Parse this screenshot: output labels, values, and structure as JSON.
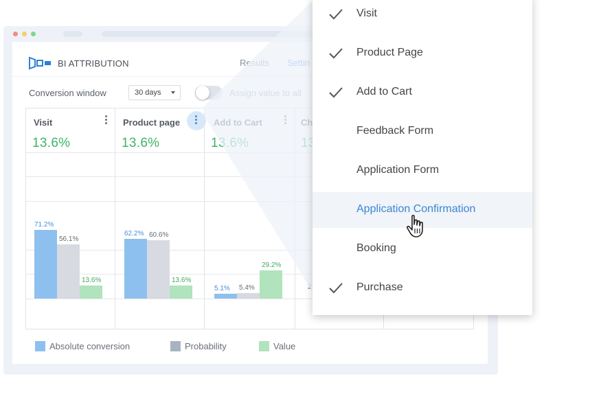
{
  "app": {
    "name": "BI ATTRIBUTION"
  },
  "tabs": [
    {
      "label": "Results"
    },
    {
      "label": "Settin"
    }
  ],
  "controls": {
    "conversion_window_label": "Conversion window",
    "conversion_window_value": "30 days",
    "assign_label": "Assign value to all",
    "assign_toggle_on": false
  },
  "columns": [
    {
      "name": "Visit",
      "value": "13.6%"
    },
    {
      "name": "Product page",
      "value": "13.6%"
    },
    {
      "name": "Add to Cart",
      "value": "13.6%"
    },
    {
      "name": "Ch",
      "value": "13"
    }
  ],
  "chart_data": {
    "type": "bar",
    "categories": [
      "Visit",
      "Product page",
      "Add to Cart"
    ],
    "series": [
      {
        "name": "Absolute conversion",
        "values": [
          71.2,
          62.2,
          5.1
        ]
      },
      {
        "name": "Probability",
        "values": [
          56.1,
          60.6,
          5.4
        ]
      },
      {
        "name": "Value",
        "values": [
          13.6,
          13.6,
          29.2
        ]
      }
    ],
    "value_labels": {
      "Absolute conversion": [
        "71.2%",
        "62.2%",
        "5.1%"
      ],
      "Probability": [
        "56.1%",
        "60.6%",
        "5.4%"
      ],
      "Value": [
        "13.6%",
        "13.6%",
        "29.2%"
      ]
    },
    "partial_label": "2",
    "legend_position": "bottom-left",
    "colors": {
      "Absolute conversion": "#8ec0ef",
      "Probability": "#d7dbe1",
      "Value": "#b1e3bc"
    }
  },
  "legend": [
    {
      "label": "Absolute conversion",
      "color": "#8ec0ef"
    },
    {
      "label": "Probability",
      "color": "#a8b3c2"
    },
    {
      "label": "Value",
      "color": "#b1e3bc"
    }
  ],
  "dropdown": {
    "items": [
      {
        "label": "Visit",
        "checked": true
      },
      {
        "label": "Product Page",
        "checked": true
      },
      {
        "label": "Add to Cart",
        "checked": true
      },
      {
        "label": "Feedback Form",
        "checked": false
      },
      {
        "label": "Application Form",
        "checked": false
      },
      {
        "label": "Application Confirmation",
        "checked": false,
        "hovered": true
      },
      {
        "label": "Booking",
        "checked": false
      },
      {
        "label": "Purchase",
        "checked": true
      }
    ]
  },
  "colors": {
    "accent": "#4a90d9",
    "positive": "#3fb468",
    "window_dots": [
      "#f07b7b",
      "#f5c75c",
      "#6ccf84"
    ]
  }
}
